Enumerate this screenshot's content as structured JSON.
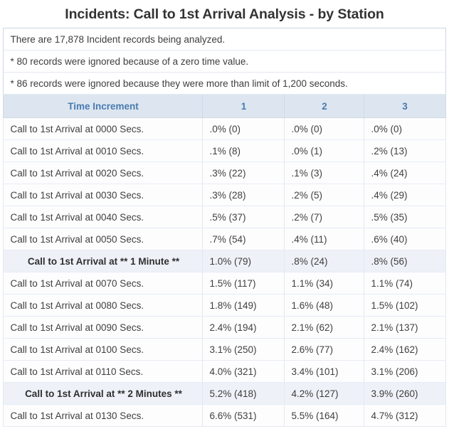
{
  "header": {
    "title": "Incidents: Call to 1st Arrival Analysis - by Station"
  },
  "info_lines": [
    "There are 17,878 Incident records being analyzed.",
    "* 80 records were ignored because of a zero time value.",
    "* 86 records were ignored because they were more than limit of 1,200 seconds."
  ],
  "table": {
    "columns": [
      "Time Increment",
      "1",
      "2",
      "3"
    ],
    "rows": [
      {
        "label": "Call to 1st Arrival at 0000 Secs.",
        "milestone": false,
        "values": [
          ".0% (0)",
          ".0% (0)",
          ".0% (0)"
        ]
      },
      {
        "label": "Call to 1st Arrival at 0010 Secs.",
        "milestone": false,
        "values": [
          ".1% (8)",
          ".0% (1)",
          ".2% (13)"
        ]
      },
      {
        "label": "Call to 1st Arrival at 0020 Secs.",
        "milestone": false,
        "values": [
          ".3% (22)",
          ".1% (3)",
          ".4% (24)"
        ]
      },
      {
        "label": "Call to 1st Arrival at 0030 Secs.",
        "milestone": false,
        "values": [
          ".3% (28)",
          ".2% (5)",
          ".4% (29)"
        ]
      },
      {
        "label": "Call to 1st Arrival at 0040 Secs.",
        "milestone": false,
        "values": [
          ".5% (37)",
          ".2% (7)",
          ".5% (35)"
        ]
      },
      {
        "label": "Call to 1st Arrival at 0050 Secs.",
        "milestone": false,
        "values": [
          ".7% (54)",
          ".4% (11)",
          ".6% (40)"
        ]
      },
      {
        "label": "Call to 1st Arrival at ** 1 Minute **",
        "milestone": true,
        "values": [
          "1.0% (79)",
          ".8% (24)",
          ".8% (56)"
        ]
      },
      {
        "label": "Call to 1st Arrival at 0070 Secs.",
        "milestone": false,
        "values": [
          "1.5% (117)",
          "1.1% (34)",
          "1.1% (74)"
        ]
      },
      {
        "label": "Call to 1st Arrival at 0080 Secs.",
        "milestone": false,
        "values": [
          "1.8% (149)",
          "1.6% (48)",
          "1.5% (102)"
        ]
      },
      {
        "label": "Call to 1st Arrival at 0090 Secs.",
        "milestone": false,
        "values": [
          "2.4% (194)",
          "2.1% (62)",
          "2.1% (137)"
        ]
      },
      {
        "label": "Call to 1st Arrival at 0100 Secs.",
        "milestone": false,
        "values": [
          "3.1% (250)",
          "2.6% (77)",
          "2.4% (162)"
        ]
      },
      {
        "label": "Call to 1st Arrival at 0110 Secs.",
        "milestone": false,
        "values": [
          "4.0% (321)",
          "3.4% (101)",
          "3.1% (206)"
        ]
      },
      {
        "label": "Call to 1st Arrival at ** 2 Minutes **",
        "milestone": true,
        "values": [
          "5.2% (418)",
          "4.2% (127)",
          "3.9% (260)"
        ]
      },
      {
        "label": "Call to 1st Arrival at 0130 Secs.",
        "milestone": false,
        "values": [
          "6.6% (531)",
          "5.5% (164)",
          "4.7% (312)"
        ]
      }
    ]
  }
}
